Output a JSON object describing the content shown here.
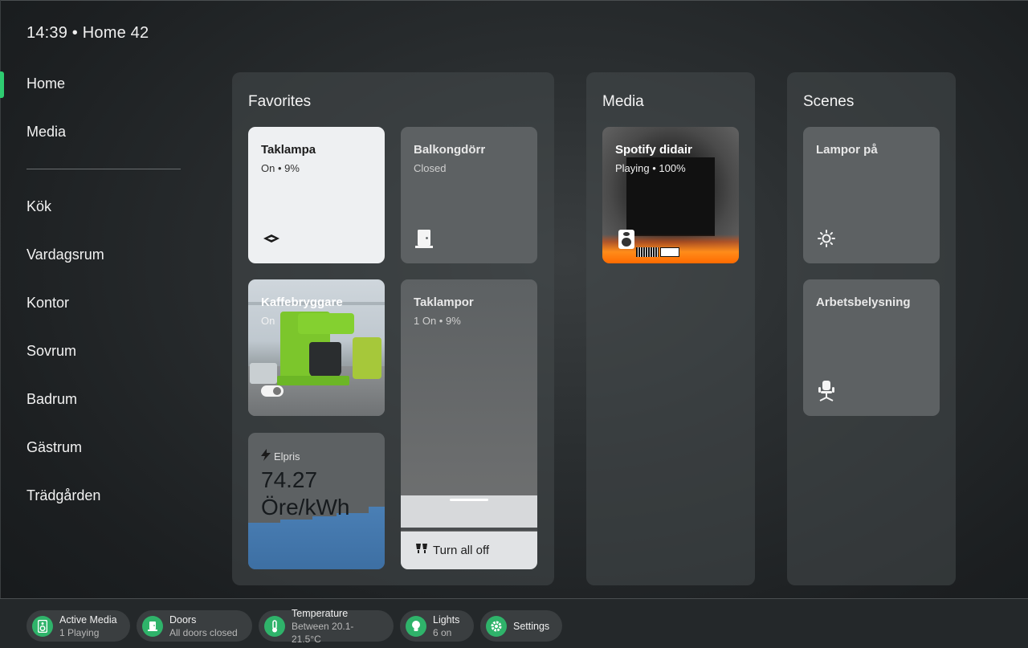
{
  "header": {
    "time_home": "14:39 • Home 42"
  },
  "sidebar": {
    "items": [
      {
        "label": "Home",
        "active": true
      },
      {
        "label": "Media"
      },
      {
        "label": "Kök"
      },
      {
        "label": "Vardagsrum"
      },
      {
        "label": "Kontor"
      },
      {
        "label": "Sovrum"
      },
      {
        "label": "Badrum"
      },
      {
        "label": "Gästrum"
      },
      {
        "label": "Trädgården"
      }
    ]
  },
  "favorites": {
    "title": "Favorites",
    "taklampa": {
      "title": "Taklampa",
      "status": "On • 9%",
      "icon": "ceiling-light-icon"
    },
    "balkongdorr": {
      "title": "Balkongdörr",
      "status": "Closed",
      "icon": "door-icon"
    },
    "kaffebryggare": {
      "title": "Kaffebryggare",
      "status": "On",
      "icon": "toggle-icon"
    },
    "taklampor": {
      "title": "Taklampor",
      "status": "1 On • 9%",
      "turn_off_label": "Turn all off",
      "icon": "lamps-icon"
    },
    "elpris": {
      "label": "Elpris",
      "value": "74.27",
      "unit": "Öre/kWh",
      "icon": "lightning-icon"
    }
  },
  "media": {
    "title": "Media",
    "spotify": {
      "title": "Spotify didair",
      "status": "Playing • 100%",
      "icon": "speaker-icon"
    }
  },
  "scenes": {
    "title": "Scenes",
    "items": [
      {
        "title": "Lampor på",
        "icon": "sun-icon"
      },
      {
        "title": "Arbetsbelysning",
        "icon": "office-chair-icon"
      }
    ]
  },
  "bottombar": {
    "active_media": {
      "label": "Active Media",
      "sub": "1 Playing"
    },
    "doors": {
      "label": "Doors",
      "sub": "All doors closed"
    },
    "temperature": {
      "label": "Temperature",
      "sub": "Between 20.1-21.5°C"
    },
    "lights": {
      "label": "Lights",
      "sub": "6 on"
    },
    "settings": {
      "label": "Settings"
    }
  },
  "colors": {
    "accent": "#2ecc71",
    "pill_icon": "#2fb36a",
    "elpris_fill": "#4a7fb5"
  }
}
